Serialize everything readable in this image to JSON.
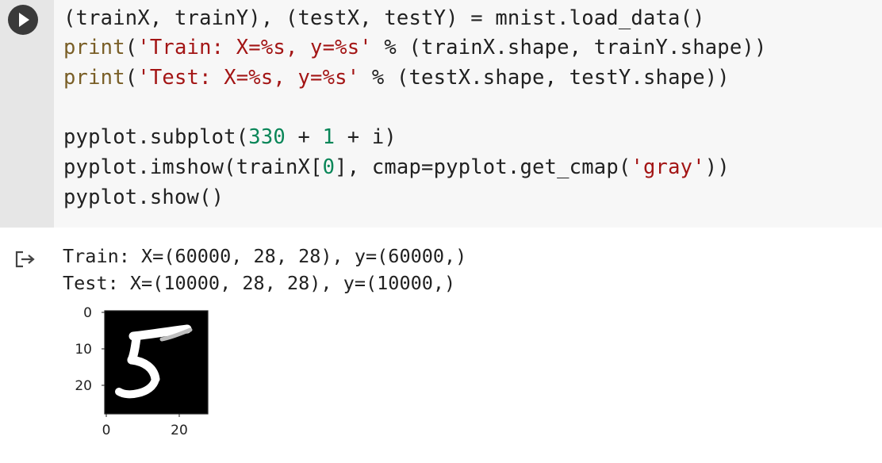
{
  "code_cell": {
    "run_icon": "play-icon",
    "lines": [
      "(trainX, trainY), (testX, testY) = mnist.load_data()",
      "print('Train: X=%s, y=%s' % (trainX.shape, trainY.shape))",
      "print('Test: X=%s, y=%s' % (testX.shape, testY.shape))",
      "",
      "pyplot.subplot(330 + 1 + i)",
      "pyplot.imshow(trainX[0], cmap=pyplot.get_cmap('gray'))",
      "pyplot.show()"
    ]
  },
  "output": {
    "icon": "output-redirect-icon",
    "lines": [
      "Train: X=(60000, 28, 28), y=(60000,)",
      "Test: X=(10000, 28, 28), y=(10000,)"
    ]
  },
  "plot": {
    "image": "mnist-digit-5",
    "y_ticks": [
      "0",
      "10",
      "20"
    ],
    "x_ticks": [
      "0",
      "20"
    ],
    "colormap": "gray"
  }
}
